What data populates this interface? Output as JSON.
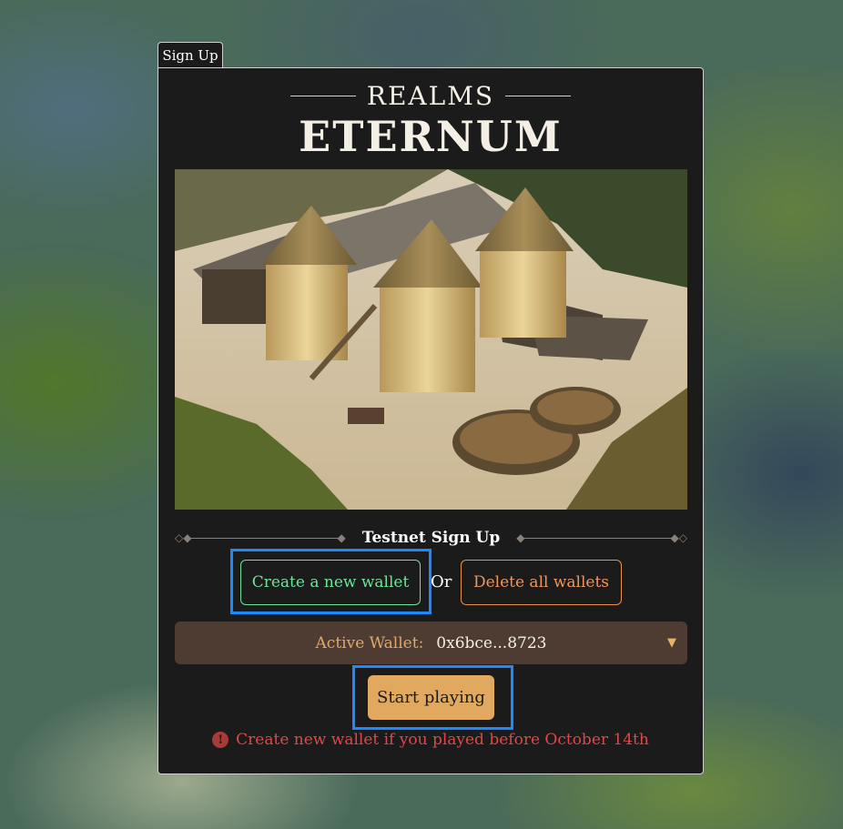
{
  "tab": {
    "label": "Sign Up"
  },
  "logo": {
    "top": "REALMS",
    "main": "ETERNUM"
  },
  "section": {
    "title": "Testnet Sign Up"
  },
  "actions": {
    "create_wallet": "Create a new wallet",
    "or": "Or",
    "delete_wallets": "Delete all wallets"
  },
  "wallet": {
    "label": "Active Wallet:",
    "address": "0x6bce...8723",
    "caret_icon": "caret-down-icon"
  },
  "start": {
    "label": "Start playing"
  },
  "warning": {
    "icon": "alert-circle-icon",
    "text": "Create new wallet if you played before October 14th"
  },
  "colors": {
    "panel": "#1b1b1b",
    "green": "#6ee39a",
    "orange": "#f0965a",
    "wallet_bg": "#4e3c33",
    "start_bg": "#e0a95f",
    "warning": "#e04848",
    "highlight": "#1e88ff"
  }
}
